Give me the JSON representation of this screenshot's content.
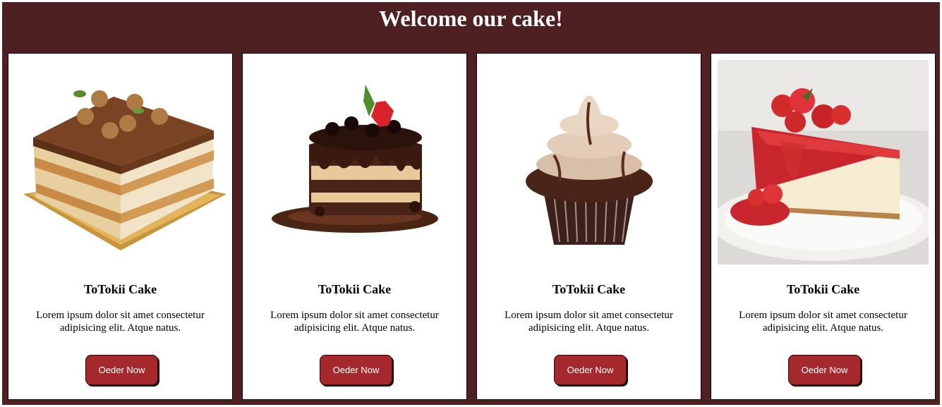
{
  "header": {
    "title": "Welcome our cake!"
  },
  "products": [
    {
      "image_icon": "tiramisu-cake-image",
      "name": "ToTokii Cake",
      "description": "Lorem ipsum dolor sit amet consectetur adipisicing elit. Atque natus.",
      "button_label": "Oeder Now"
    },
    {
      "image_icon": "chocolate-drip-cake-image",
      "name": "ToTokii Cake",
      "description": "Lorem ipsum dolor sit amet consectetur adipisicing elit. Atque natus.",
      "button_label": "Oeder Now"
    },
    {
      "image_icon": "chocolate-cupcake-image",
      "name": "ToTokii Cake",
      "description": "Lorem ipsum dolor sit amet consectetur adipisicing elit. Atque natus.",
      "button_label": "Oeder Now"
    },
    {
      "image_icon": "strawberry-cheesecake-image",
      "name": "ToTokii Cake",
      "description": "Lorem ipsum dolor sit amet consectetur adipisicing elit. Atque natus.",
      "button_label": "Oeder Now"
    }
  ],
  "colors": {
    "background": "#4f2022",
    "card": "#ffffff",
    "button": "#a5282c",
    "button_text": "#ffffff",
    "title_text": "#ffffff"
  }
}
